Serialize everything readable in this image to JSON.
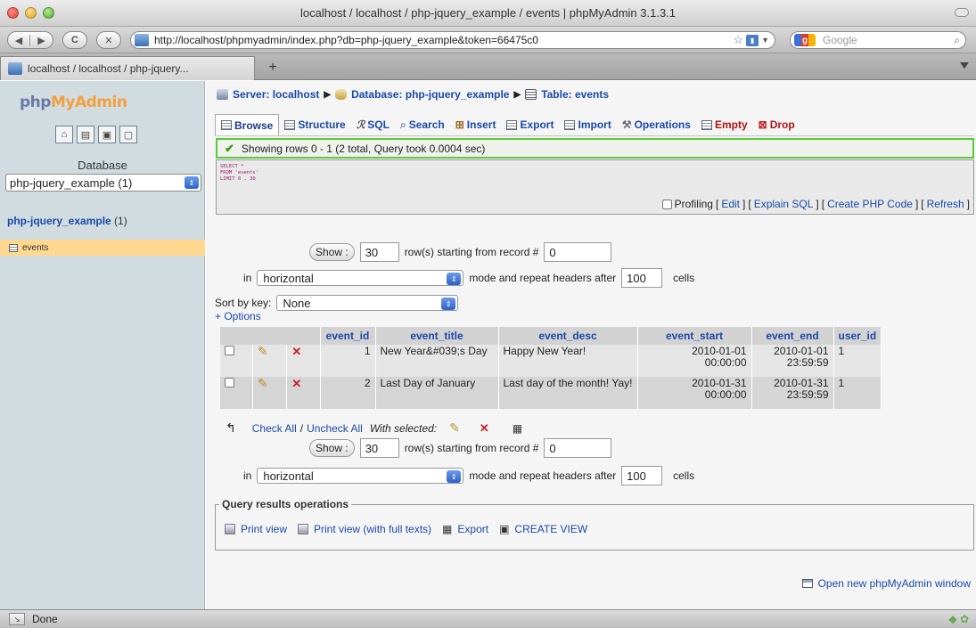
{
  "window": {
    "title": "localhost / localhost / php-jquery_example / events | phpMyAdmin 3.1.3.1"
  },
  "toolbar": {
    "back_icon": "◀",
    "forward_icon": "▶",
    "reload_icon": "C",
    "stop_icon": "✕",
    "url": "http://localhost/phpmyadmin/index.php?db=php-jquery_example&token=66475c0",
    "search_engine": "Google",
    "search_placeholder": "Google"
  },
  "browser_tab": {
    "label": "localhost / localhost / php-jquery...",
    "new_tab": "+"
  },
  "sidebar": {
    "logo_a": "php",
    "logo_b": "MyAdmin",
    "icons": [
      "home-icon",
      "sql-query-icon",
      "docs-icon",
      "changelog-icon"
    ],
    "database_label": "Database",
    "database_select": "php-jquery_example (1)",
    "db_name": "php-jquery_example",
    "db_count": "(1)",
    "tables": [
      "events"
    ]
  },
  "breadcrumb": {
    "server": "Server: localhost",
    "database": "Database: php-jquery_example",
    "table": "Table: events",
    "sep": "▶"
  },
  "tabs": [
    {
      "label": "Browse",
      "icon": "browse-icon"
    },
    {
      "label": "Structure",
      "icon": "structure-icon"
    },
    {
      "label": "SQL",
      "icon": "sql-icon"
    },
    {
      "label": "Search",
      "icon": "search-icon"
    },
    {
      "label": "Insert",
      "icon": "insert-icon"
    },
    {
      "label": "Export",
      "icon": "export-icon"
    },
    {
      "label": "Import",
      "icon": "import-icon"
    },
    {
      "label": "Operations",
      "icon": "operations-icon"
    },
    {
      "label": "Empty",
      "icon": "empty-icon"
    },
    {
      "label": "Drop",
      "icon": "drop-icon"
    }
  ],
  "notice": {
    "text": "Showing rows 0 - 1 (2 total, Query took 0.0004 sec)"
  },
  "sql": {
    "line1": "SELECT *",
    "line2": "FROM 'events'",
    "line3": "LIMIT 0 , 30"
  },
  "profiling": {
    "label": "Profiling",
    "edit": "Edit",
    "explain": "Explain SQL",
    "create_php": "Create PHP Code",
    "refresh": "Refresh"
  },
  "nav": {
    "show_button": "Show :",
    "rows_value": "30",
    "starting_text": "row(s) starting from record #",
    "start_value": "0",
    "in_text": "in",
    "mode_value": "horizontal",
    "mode_text": "mode and repeat headers after",
    "headers_value": "100",
    "cells_text": "cells"
  },
  "sort": {
    "label": "Sort by key:",
    "value": "None"
  },
  "options_link": "+ Options",
  "results": {
    "columns": [
      "event_id",
      "event_title",
      "event_desc",
      "event_start",
      "event_end",
      "user_id"
    ],
    "rows": [
      {
        "event_id": "1",
        "event_title": "New Year&#039;s Day",
        "event_desc": "Happy New Year!",
        "event_start_date": "2010-01-01",
        "event_start_time": "00:00:00",
        "event_end_date": "2010-01-01",
        "event_end_time": "23:59:59",
        "user_id": "1"
      },
      {
        "event_id": "2",
        "event_title": "Last Day of January",
        "event_desc": "Last day of the month! Yay!",
        "event_start_date": "2010-01-31",
        "event_start_time": "00:00:00",
        "event_end_date": "2010-01-31",
        "event_end_time": "23:59:59",
        "user_id": "1"
      }
    ]
  },
  "with_selected": {
    "check_all": "Check All",
    "slash": "/",
    "uncheck_all": "Uncheck All",
    "label": "With selected:"
  },
  "query_ops": {
    "legend": "Query results operations",
    "print_view": "Print view",
    "print_full": "Print view (with full texts)",
    "export": "Export",
    "create_view": "CREATE VIEW"
  },
  "new_window_link": "Open new phpMyAdmin window",
  "status": {
    "text": "Done"
  }
}
